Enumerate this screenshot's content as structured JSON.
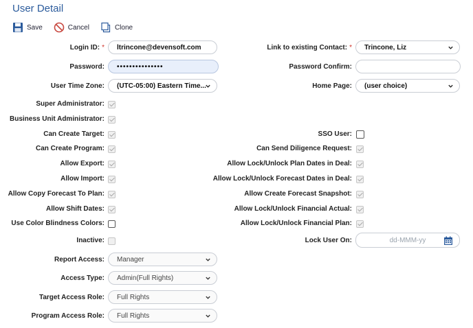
{
  "page": {
    "title": "User Detail"
  },
  "toolbar": {
    "save": "Save",
    "cancel": "Cancel",
    "clone": "Clone"
  },
  "left": {
    "login_id": {
      "label": "Login ID:",
      "value": "ltrincone@devensoft.com"
    },
    "password": {
      "label": "Password:",
      "value": "•••••••••••••••"
    },
    "time_zone": {
      "label": "User Time Zone:",
      "value": "(UTC-05:00) Eastern Time..."
    },
    "super_admin": {
      "label": "Super Administrator:",
      "checked": true
    },
    "bu_admin": {
      "label": "Business Unit Administrator:",
      "checked": true
    },
    "create_target": {
      "label": "Can Create Target:",
      "checked": true
    },
    "create_program": {
      "label": "Can Create Program:",
      "checked": true
    },
    "allow_export": {
      "label": "Allow Export:",
      "checked": true
    },
    "allow_import": {
      "label": "Allow Import:",
      "checked": true
    },
    "copy_forecast": {
      "label": "Allow Copy Forecast To Plan:",
      "checked": true
    },
    "shift_dates": {
      "label": "Allow Shift Dates:",
      "checked": true
    },
    "color_blind": {
      "label": "Use Color Blindness Colors:",
      "checked": false
    },
    "inactive": {
      "label": "Inactive:",
      "checked": false
    },
    "report_access": {
      "label": "Report Access:",
      "value": "Manager"
    },
    "access_type": {
      "label": "Access Type:",
      "value": "Admin(Full Rights)"
    },
    "target_role": {
      "label": "Target Access Role:",
      "value": "Full Rights"
    },
    "program_role": {
      "label": "Program Access Role:",
      "value": "Full Rights"
    }
  },
  "right": {
    "link_contact": {
      "label": "Link to existing Contact:",
      "value": "Trincone, Liz"
    },
    "password_confirm": {
      "label": "Password Confirm:",
      "value": ""
    },
    "home_page": {
      "label": "Home Page:",
      "value": "(user choice)"
    },
    "sso_user": {
      "label": "SSO User:",
      "checked": false
    },
    "diligence": {
      "label": "Can Send Diligence Request:",
      "checked": true
    },
    "lock_plan": {
      "label": "Allow Lock/Unlock Plan Dates in Deal:",
      "checked": true
    },
    "lock_forecast": {
      "label": "Allow Lock/Unlock Forecast Dates in Deal:",
      "checked": true
    },
    "forecast_snapshot": {
      "label": "Allow Create Forecast Snapshot:",
      "checked": true
    },
    "lock_fin_actual": {
      "label": "Allow Lock/Unlock Financial Actual:",
      "checked": true
    },
    "lock_fin_plan": {
      "label": "Allow Lock/Unlock Financial Plan:",
      "checked": true
    },
    "lock_user_on": {
      "label": "Lock User On:",
      "placeholder": "dd-MMM-yy"
    }
  },
  "colors": {
    "title": "#2b5b9c",
    "required": "#d0342c",
    "calendar": "#2b5b9c"
  },
  "icons": {
    "save": "floppy-disk-icon",
    "cancel": "no-entry-icon",
    "clone": "copy-icon",
    "calendar": "calendar-icon",
    "dropdown": "chevron-down-icon"
  }
}
